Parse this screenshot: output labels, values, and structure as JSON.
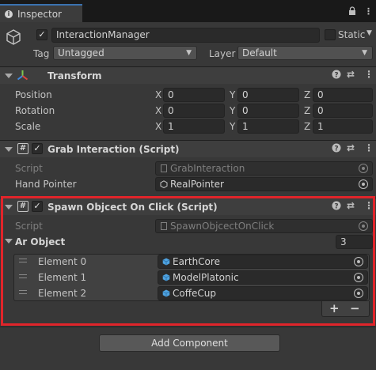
{
  "tab": {
    "title": "Inspector"
  },
  "gameobject": {
    "active": true,
    "name": "InteractionManager",
    "static_label": "Static",
    "tag_label": "Tag",
    "tag_value": "Untagged",
    "layer_label": "Layer",
    "layer_value": "Default"
  },
  "transform": {
    "title": "Transform",
    "rows": [
      {
        "label": "Position",
        "x": "0",
        "y": "0",
        "z": "0"
      },
      {
        "label": "Rotation",
        "x": "0",
        "y": "0",
        "z": "0"
      },
      {
        "label": "Scale",
        "x": "1",
        "y": "1",
        "z": "1"
      }
    ],
    "axis_x": "X",
    "axis_y": "Y",
    "axis_z": "Z"
  },
  "grab": {
    "title": "Grab Interaction (Script)",
    "enabled": true,
    "script_label": "Script",
    "script_value": "GrabInteraction",
    "pointer_label": "Hand Pointer",
    "pointer_value": "RealPointer"
  },
  "spawn": {
    "title": "Spawn Objcect On Click (Script)",
    "enabled": true,
    "script_label": "Script",
    "script_value": "SpawnObjcectOnClick",
    "array_label": "Ar Object",
    "array_size": "3",
    "elements": [
      {
        "label": "Element 0",
        "value": "EarthCore"
      },
      {
        "label": "Element 1",
        "value": "ModelPlatonic"
      },
      {
        "label": "Element 2",
        "value": "CoffeCup"
      }
    ],
    "add_symbol": "+",
    "remove_symbol": "−"
  },
  "footer": {
    "add_component": "Add Component"
  },
  "icons": {
    "help": "?",
    "presets": "⇄",
    "menu": "⋮",
    "lock": "🔒",
    "more": "⋮",
    "check": "✓",
    "hash": "#"
  },
  "colors": {
    "highlight": "#e1242a",
    "prefab_blue": "#4fa3e0",
    "tab_accent": "#3a72b0"
  }
}
